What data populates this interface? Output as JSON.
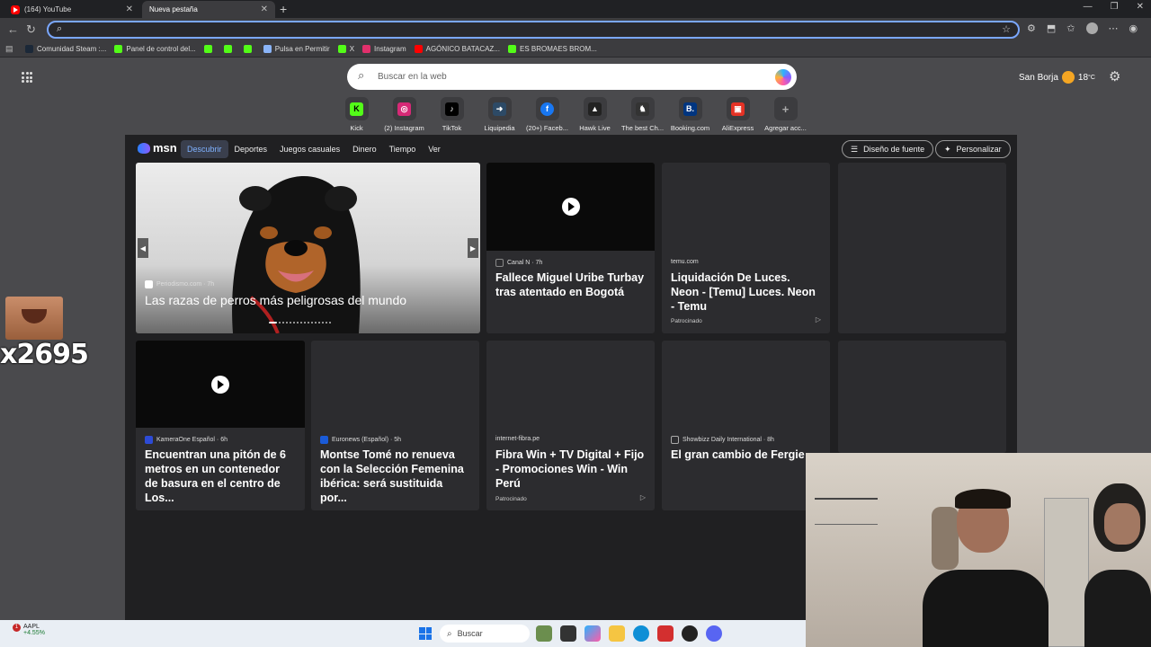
{
  "tabs": [
    {
      "title": "(164) YouTube",
      "active": false,
      "icon": "youtube-icon"
    },
    {
      "title": "Nueva pestaña",
      "active": true,
      "icon": "page-icon"
    }
  ],
  "omnibox": {
    "value": ""
  },
  "bookmarks": [
    {
      "label": "Comunidad Steam :...",
      "icon": "steam-icon",
      "color": "#1b2838"
    },
    {
      "label": "Panel de control del...",
      "icon": "kick-icon",
      "color": "#53fc18"
    },
    {
      "label": "",
      "icon": "kick-icon",
      "color": "#53fc18"
    },
    {
      "label": "",
      "icon": "kick-icon",
      "color": "#53fc18"
    },
    {
      "label": "",
      "icon": "kick-icon",
      "color": "#53fc18"
    },
    {
      "label": "Pulsa en Permitir",
      "icon": "bell-icon",
      "color": "#8ab4f8"
    },
    {
      "label": "X",
      "icon": "kick-icon",
      "color": "#53fc18"
    },
    {
      "label": "Instagram",
      "icon": "instagram-icon",
      "color": "#e1306c"
    },
    {
      "label": "AGÓNICO BATACAZ...",
      "icon": "youtube-icon",
      "color": "#ff0000"
    },
    {
      "label": "ES BROMAES BROM...",
      "icon": "kick-icon",
      "color": "#53fc18"
    }
  ],
  "search": {
    "placeholder": "Buscar en la web"
  },
  "weather": {
    "location": "San Borja",
    "temp": "18",
    "unit": "°C"
  },
  "quicklinks": [
    {
      "label": "Kick",
      "glyph": "K",
      "color": "#53fc18",
      "icon": "kick-icon"
    },
    {
      "label": "(2) Instagram",
      "glyph": "◎",
      "color": "#d62976",
      "icon": "instagram-icon"
    },
    {
      "label": "TikTok",
      "glyph": "♪",
      "color": "#000000",
      "icon": "tiktok-icon"
    },
    {
      "label": "Liquipedia",
      "glyph": "➜",
      "color": "#2d4a66",
      "icon": "liquipedia-icon"
    },
    {
      "label": "(20+) Faceb...",
      "glyph": "f",
      "color": "#1877f2",
      "icon": "facebook-icon"
    },
    {
      "label": "Hawk Live",
      "glyph": "▲",
      "color": "#222222",
      "icon": "hawk-icon"
    },
    {
      "label": "The best Ch...",
      "glyph": "♞",
      "color": "#333333",
      "icon": "chess-icon"
    },
    {
      "label": "Booking.com",
      "glyph": "B.",
      "color": "#003580",
      "icon": "booking-icon"
    },
    {
      "label": "AliExpress",
      "glyph": "▣",
      "color": "#e43225",
      "icon": "aliexpress-icon"
    },
    {
      "label": "Agregar acc...",
      "glyph": "+",
      "color": "#3c3c3f",
      "icon": "plus-icon"
    }
  ],
  "feed": {
    "brand": "msn",
    "nav": [
      "Descubrir",
      "Deportes",
      "Juegos casuales",
      "Dinero",
      "Tiempo",
      "Ver"
    ],
    "font_button": "Diseño de fuente",
    "personalize_button": "Personalizar",
    "hero": {
      "source": "Periodismo.com · 7h",
      "headline": "Las razas de perros más peligrosas del mundo"
    },
    "cards": [
      {
        "source": "Canal N · 7h",
        "headline": "Fallece Miguel Uribe Turbay tras atentado en Bogotá"
      },
      {
        "source": "temu.com",
        "headline": "Liquidación De Luces. Neon - [Temu] Luces. Neon - Temu",
        "sponsored": "Patrocinado"
      },
      {
        "source": "KameraOne Español · 6h",
        "headline": "Encuentran una pitón de 6 metros en un contenedor de basura en el centro de Los..."
      },
      {
        "source": "Euronews (Español) · 5h",
        "headline": "Montse Tomé no renueva con la Selección Femenina ibérica: será sustituida por..."
      },
      {
        "source": "internet-fibra.pe",
        "headline": "Fibra Win + TV Digital + Fijo - Promociones Win - Win Perú",
        "sponsored": "Patrocinado"
      },
      {
        "source": "Showbizz Daily International · 8h",
        "headline": "El gran cambio de Fergie"
      }
    ]
  },
  "overlay": {
    "sticker_text": "x2695"
  },
  "taskbar": {
    "stock": {
      "ticker": "AAPL",
      "change": "+4.55%",
      "badge": "1"
    },
    "search_label": "Buscar"
  }
}
